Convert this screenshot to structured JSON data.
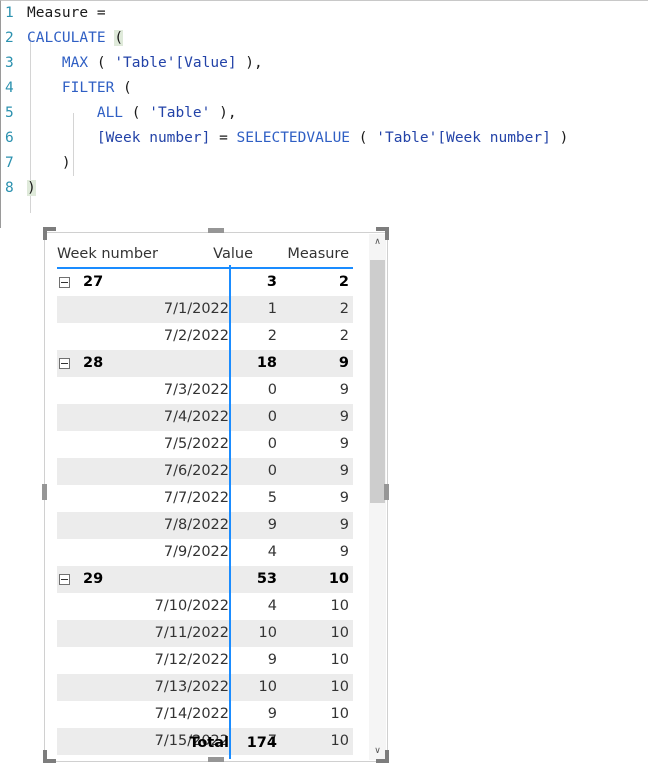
{
  "editor": {
    "name": "dax-formula-editor",
    "language": "DAX",
    "lines": [
      {
        "n": "1",
        "tokens": [
          {
            "t": "Measure =",
            "k": "plain"
          }
        ]
      },
      {
        "n": "2",
        "tokens": [
          {
            "t": "CALCULATE",
            "k": "fn"
          },
          {
            "t": " ",
            "k": "plain"
          },
          {
            "t": "(",
            "k": "match"
          }
        ]
      },
      {
        "n": "3",
        "tokens": [
          {
            "t": "    ",
            "k": "plain"
          },
          {
            "t": "MAX",
            "k": "fn"
          },
          {
            "t": " ( ",
            "k": "punct"
          },
          {
            "t": "'Table'[Value]",
            "k": "ref"
          },
          {
            "t": " ),",
            "k": "punct"
          }
        ]
      },
      {
        "n": "4",
        "tokens": [
          {
            "t": "    ",
            "k": "plain"
          },
          {
            "t": "FILTER",
            "k": "fn"
          },
          {
            "t": " (",
            "k": "punct"
          }
        ]
      },
      {
        "n": "5",
        "tokens": [
          {
            "t": "        ",
            "k": "plain"
          },
          {
            "t": "ALL",
            "k": "fn"
          },
          {
            "t": " ( ",
            "k": "punct"
          },
          {
            "t": "'Table'",
            "k": "ref"
          },
          {
            "t": " ),",
            "k": "punct"
          }
        ]
      },
      {
        "n": "6",
        "tokens": [
          {
            "t": "        ",
            "k": "plain"
          },
          {
            "t": "[Week number]",
            "k": "ref"
          },
          {
            "t": " = ",
            "k": "op"
          },
          {
            "t": "SELECTEDVALUE",
            "k": "fn"
          },
          {
            "t": " ( ",
            "k": "punct"
          },
          {
            "t": "'Table'[Week number]",
            "k": "ref"
          },
          {
            "t": " )",
            "k": "punct"
          }
        ]
      },
      {
        "n": "7",
        "tokens": [
          {
            "t": "    ",
            "k": "plain"
          },
          {
            "t": ")",
            "k": "punct"
          }
        ]
      },
      {
        "n": "8",
        "tokens": [
          {
            "t": ")",
            "k": "match"
          }
        ]
      }
    ]
  },
  "table_visual": {
    "name": "matrix-visual",
    "columns": [
      "Week number",
      "Value",
      "Measure"
    ],
    "rows": [
      {
        "type": "group",
        "label": "27",
        "value": "3",
        "measure": "2",
        "expanded": true,
        "shaded": false
      },
      {
        "type": "detail",
        "label": "7/1/2022",
        "value": "1",
        "measure": "2",
        "shaded": true
      },
      {
        "type": "detail",
        "label": "7/2/2022",
        "value": "2",
        "measure": "2",
        "shaded": false
      },
      {
        "type": "group",
        "label": "28",
        "value": "18",
        "measure": "9",
        "expanded": true,
        "shaded": true
      },
      {
        "type": "detail",
        "label": "7/3/2022",
        "value": "0",
        "measure": "9",
        "shaded": false
      },
      {
        "type": "detail",
        "label": "7/4/2022",
        "value": "0",
        "measure": "9",
        "shaded": true
      },
      {
        "type": "detail",
        "label": "7/5/2022",
        "value": "0",
        "measure": "9",
        "shaded": false
      },
      {
        "type": "detail",
        "label": "7/6/2022",
        "value": "0",
        "measure": "9",
        "shaded": true
      },
      {
        "type": "detail",
        "label": "7/7/2022",
        "value": "5",
        "measure": "9",
        "shaded": false
      },
      {
        "type": "detail",
        "label": "7/8/2022",
        "value": "9",
        "measure": "9",
        "shaded": true
      },
      {
        "type": "detail",
        "label": "7/9/2022",
        "value": "4",
        "measure": "9",
        "shaded": false
      },
      {
        "type": "group",
        "label": "29",
        "value": "53",
        "measure": "10",
        "expanded": true,
        "shaded": true
      },
      {
        "type": "detail",
        "label": "7/10/2022",
        "value": "4",
        "measure": "10",
        "shaded": false
      },
      {
        "type": "detail",
        "label": "7/11/2022",
        "value": "10",
        "measure": "10",
        "shaded": true
      },
      {
        "type": "detail",
        "label": "7/12/2022",
        "value": "9",
        "measure": "10",
        "shaded": false
      },
      {
        "type": "detail",
        "label": "7/13/2022",
        "value": "10",
        "measure": "10",
        "shaded": true
      },
      {
        "type": "detail",
        "label": "7/14/2022",
        "value": "9",
        "measure": "10",
        "shaded": false
      },
      {
        "type": "detail",
        "label": "7/15/2022",
        "value": "7",
        "measure": "10",
        "shaded": true
      }
    ],
    "total": {
      "label": "Total",
      "value": "174",
      "measure": ""
    },
    "scrollbar": {
      "up_arrow_icon": "chevron-up-icon",
      "down_arrow_icon": "chevron-down-icon",
      "up_glyph": "∧",
      "down_glyph": "∨"
    },
    "expand_icon": "collapse-minus-icon"
  },
  "colors": {
    "accent_blue": "#1a8cff",
    "code_function": "#2f5fc4",
    "code_reference": "#2343a8",
    "line_number": "#2b91af",
    "row_alt": "#ececec",
    "bracket_match_bg": "#dfeada",
    "handle": "#969696"
  }
}
